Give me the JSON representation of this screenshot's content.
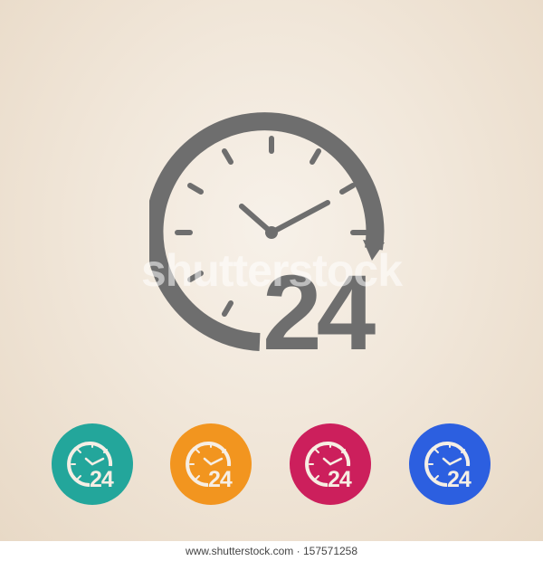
{
  "icon": {
    "number": "24",
    "name": "clock-24-icon",
    "colors": {
      "main": "#6e6e6e",
      "light": "#f6eee4"
    }
  },
  "variants": [
    {
      "name": "teal",
      "color": "#23a69b"
    },
    {
      "name": "orange",
      "color": "#f2951f"
    },
    {
      "name": "magenta",
      "color": "#cc1f5c"
    },
    {
      "name": "blue",
      "color": "#2c5fe0"
    }
  ],
  "watermark": "shutterstock",
  "footer": "www.shutterstock.com · 157571258"
}
